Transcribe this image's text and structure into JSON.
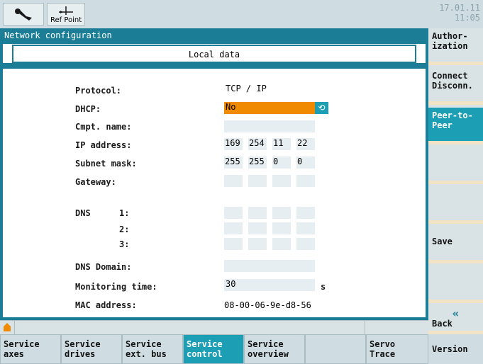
{
  "topbar": {
    "ref_point_label": "Ref Point",
    "date": "17.01.11",
    "time": "11:05",
    "tool_icon": "wrench-icon",
    "ref_icon": "ref-point-icon"
  },
  "panel": {
    "title": "Network configuration",
    "subtitle": "Local data",
    "fields": {
      "protocol": {
        "label": "Protocol:",
        "value": "TCP / IP"
      },
      "dhcp": {
        "label": "DHCP:",
        "value": "No"
      },
      "cmpt_name": {
        "label": "Cmpt. name:",
        "value": ""
      },
      "ip_address": {
        "label": "IP address:",
        "octets": [
          "169",
          "254",
          "11",
          "22"
        ]
      },
      "subnet_mask": {
        "label": "Subnet mask:",
        "octets": [
          "255",
          "255",
          "0",
          "0"
        ]
      },
      "gateway": {
        "label": "Gateway:",
        "octets": [
          "",
          "",
          "",
          ""
        ]
      },
      "dns": {
        "label": "DNS",
        "rows": [
          "1:",
          "2:",
          "3:"
        ]
      },
      "dns_domain": {
        "label": "DNS Domain:",
        "value": ""
      },
      "monitoring_time": {
        "label": "Monitoring time:",
        "value": "30",
        "unit": "s"
      },
      "mac_address": {
        "label": "MAC address:",
        "value": "08-00-06-9e-d8-56"
      }
    }
  },
  "right_softkeys": [
    {
      "label": "Author-\nization",
      "active": false
    },
    {
      "label": "Connect\nDisconn.",
      "active": false
    },
    {
      "label": "Peer-to-\nPeer",
      "active": true
    },
    {
      "label": "",
      "active": false
    },
    {
      "label": "",
      "active": false
    },
    {
      "label": "Save",
      "active": false
    },
    {
      "label": "",
      "active": false
    },
    {
      "label": "Back",
      "active": false
    },
    {
      "label": "Version",
      "active": false
    }
  ],
  "bottom_softkeys": [
    {
      "label": "Service\naxes",
      "active": false
    },
    {
      "label": "Service\ndrives",
      "active": false
    },
    {
      "label": "Service\next. bus",
      "active": false
    },
    {
      "label": "Service\ncontrol",
      "active": true
    },
    {
      "label": "Service\noverview",
      "active": false
    },
    {
      "label": "",
      "active": false
    },
    {
      "label": "Servo\nTrace",
      "active": false
    }
  ],
  "colors": {
    "accent": "#1c7e96",
    "active_key": "#1c9fb5",
    "highlight": "#f08a00"
  }
}
